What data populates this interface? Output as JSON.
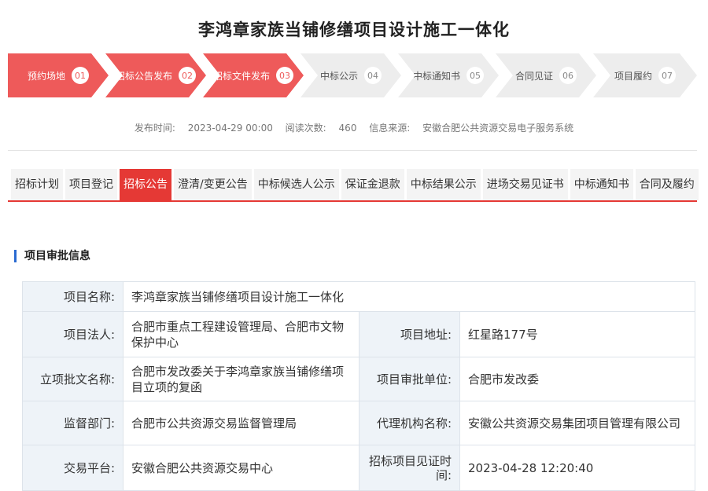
{
  "page": {
    "title": "李鸿章家族当铺修缮项目设计施工一体化"
  },
  "steps": [
    {
      "label": "预约场地",
      "num": "01",
      "done": true
    },
    {
      "label": "招标公告发布",
      "num": "02",
      "done": true
    },
    {
      "label": "招标文件发布",
      "num": "03",
      "done": true
    },
    {
      "label": "中标公示",
      "num": "04",
      "done": false
    },
    {
      "label": "中标通知书",
      "num": "05",
      "done": false
    },
    {
      "label": "合同见证",
      "num": "06",
      "done": false
    },
    {
      "label": "项目履约",
      "num": "07",
      "done": false
    }
  ],
  "meta": {
    "publish_label": "发布时间:",
    "publish_value": "2023-04-29 00:00",
    "views_label": "阅读次数:",
    "views_value": "460",
    "source_label": "信息来源:",
    "source_value": "安徽合肥公共资源交易电子服务系统"
  },
  "tabs": [
    {
      "label": "招标计划",
      "active": false
    },
    {
      "label": "项目登记",
      "active": false
    },
    {
      "label": "招标公告",
      "active": true
    },
    {
      "label": "澄清/变更公告",
      "active": false
    },
    {
      "label": "中标候选人公示",
      "active": false
    },
    {
      "label": "保证金退款",
      "active": false
    },
    {
      "label": "中标结果公示",
      "active": false
    },
    {
      "label": "进场交易见证书",
      "active": false
    },
    {
      "label": "中标通知书",
      "active": false
    },
    {
      "label": "合同及履约",
      "active": false
    }
  ],
  "section": {
    "title": "项目审批信息"
  },
  "info": {
    "name_label": "项目名称:",
    "name_value": "李鸿章家族当铺修缮项目设计施工一体化",
    "legal_label": "项目法人:",
    "legal_value": "合肥市重点工程建设管理局、合肥市文物保护中心",
    "address_label": "项目地址:",
    "address_value": "红星路177号",
    "approval_doc_label": "立项批文名称:",
    "approval_doc_value": "合肥市发改委关于李鸿章家族当铺修缮项目立项的复函",
    "approval_unit_label": "项目审批单位:",
    "approval_unit_value": "合肥市发改委",
    "supervisor_label": "监督部门:",
    "supervisor_value": "合肥市公共资源交易监督管理局",
    "agency_label": "代理机构名称:",
    "agency_value": "安徽公共资源交易集团项目管理有限公司",
    "platform_label": "交易平台:",
    "platform_value": "安徽合肥公共资源交易中心",
    "witness_time_label": "招标项目见证时间:",
    "witness_time_value": "2023-04-28 12:20:40"
  },
  "colors": {
    "accent": "#e53935",
    "step_done": "#ee5a5a",
    "step_todo": "#ededed",
    "label_bg": "#eef3f8"
  }
}
